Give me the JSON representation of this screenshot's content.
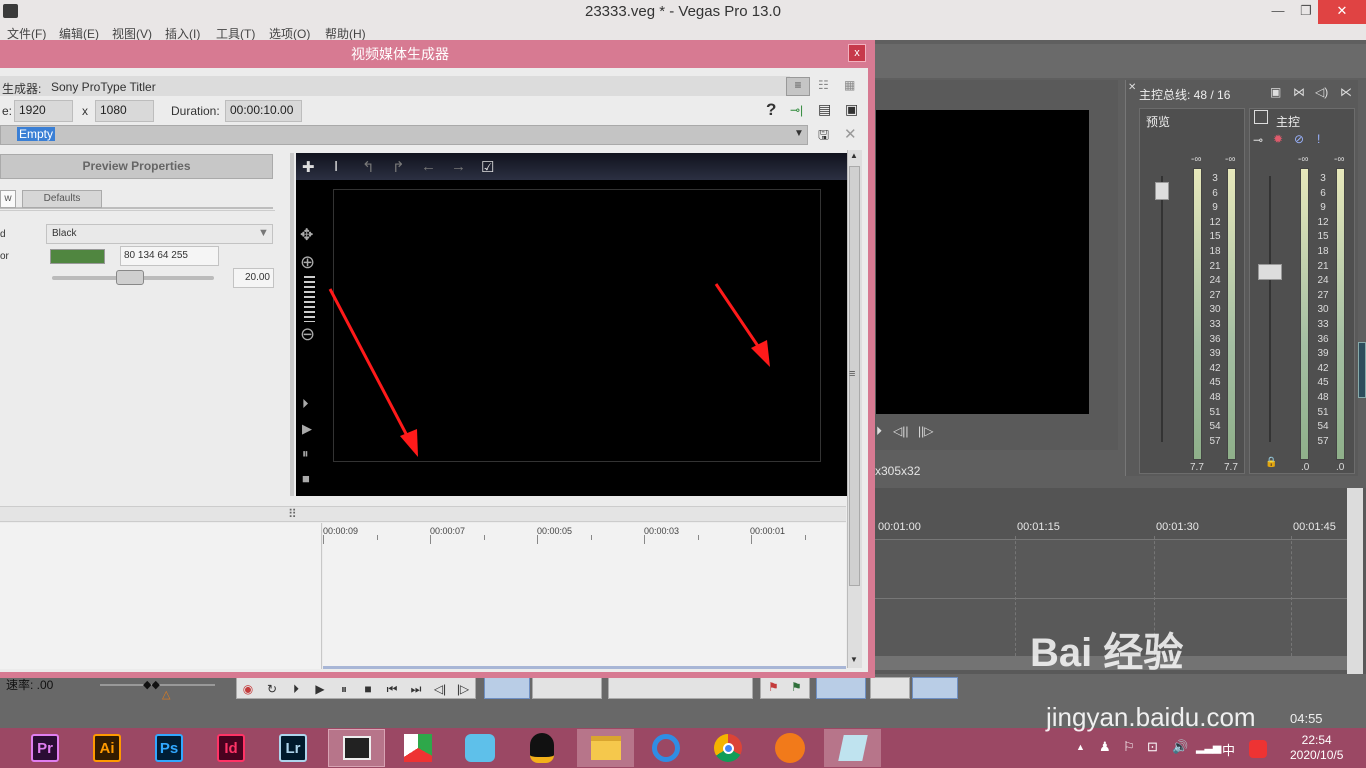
{
  "window": {
    "title": "23333.veg * - Vegas Pro 13.0",
    "minimize": "—",
    "maximize": "❐",
    "close": "✕"
  },
  "menu": [
    "文件(F)",
    "编辑(E)",
    "视图(V)",
    "插入(I)",
    "工具(T)",
    "选项(O)",
    "帮助(H)"
  ],
  "dialog": {
    "title": "视频媒体生成器",
    "close_glyph": "x",
    "generator_label": "生成器:",
    "generator_value": "Sony ProType Titler",
    "size_label": "e:",
    "width": "1920",
    "x_sep": "x",
    "height": "1080",
    "duration_label": "Duration:",
    "duration_value": "00:00:10.00",
    "preset_value": "Empty",
    "help": "?"
  },
  "properties": {
    "header": "Preview Properties",
    "tabs": [
      "w",
      "Defaults"
    ],
    "rows": [
      {
        "label": "d",
        "value": "Black"
      },
      {
        "label": "or",
        "value": "80 134 64 255",
        "swatch": "#508640"
      }
    ],
    "slider_value": "20.00",
    "slider_fraction": 0.48
  },
  "editor": {
    "toolbar": [
      "✚",
      "I",
      "↰",
      "↱",
      "←",
      "→",
      "☑"
    ],
    "side": [
      "✥",
      "⊕",
      "⊖",
      "⏵",
      "▶",
      "⏸",
      "■"
    ]
  },
  "dialog_timeline": {
    "ticks": [
      "00:00:09",
      "00:00:07",
      "00:00:05",
      "00:00:03",
      "00:00:01"
    ]
  },
  "right_panel": {
    "preview_res": "x305x32",
    "master_bus": "主控总线: 48 / 16",
    "preview_label": "预览",
    "master_label": "主控",
    "inf": "-∞",
    "scale": [
      "3",
      "6",
      "9",
      "12",
      "15",
      "18",
      "21",
      "24",
      "27",
      "30",
      "33",
      "36",
      "39",
      "42",
      "45",
      "48",
      "51",
      "54",
      "57"
    ],
    "meter_vals": [
      "7.7",
      "7.7",
      ".0",
      ".0"
    ],
    "times": [
      "00:01:00",
      "00:01:15",
      "00:01:30",
      "00:01:45"
    ]
  },
  "transport": {
    "rate_label": "速率: .00",
    "time_right": "04:55"
  },
  "taskbar": {
    "apps": [
      {
        "name": "Pr",
        "color": "#e07ef0",
        "bg": "#2a0d33"
      },
      {
        "name": "Ai",
        "color": "#ff9a00",
        "bg": "#331c00"
      },
      {
        "name": "Ps",
        "color": "#31a8ff",
        "bg": "#001e36"
      },
      {
        "name": "Id",
        "color": "#ff3366",
        "bg": "#49021f"
      },
      {
        "name": "Lr",
        "color": "#add5ec",
        "bg": "#001a2c"
      }
    ],
    "time": "22:54",
    "date": "2020/10/5",
    "ime": "中"
  },
  "watermark": {
    "brand": "Bai 经验",
    "url": "jingyan.baidu.com"
  }
}
